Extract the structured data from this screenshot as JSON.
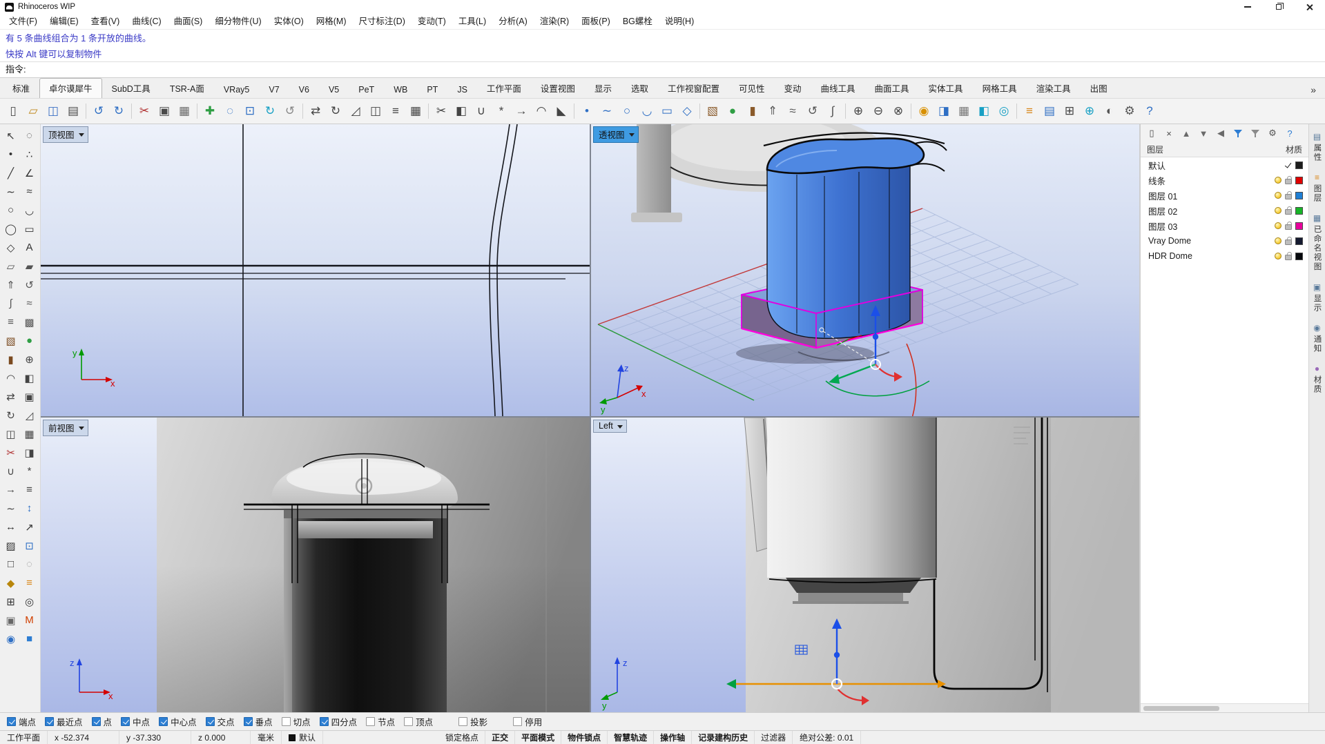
{
  "window": {
    "title": "Rhinoceros WIP"
  },
  "menu_bar": {
    "items": [
      "文件(F)",
      "编辑(E)",
      "查看(V)",
      "曲线(C)",
      "曲面(S)",
      "细分物件(U)",
      "实体(O)",
      "网格(M)",
      "尺寸标注(D)",
      "变动(T)",
      "工具(L)",
      "分析(A)",
      "渲染(R)",
      "面板(P)",
      "BG螺栓",
      "说明(H)"
    ]
  },
  "command_area": {
    "history": [
      "有 5 条曲线组合为 1 条开放的曲线。",
      "快按 Alt 键可以复制物件"
    ],
    "prompt": "指令:"
  },
  "tab_bar": {
    "active": "卓尔谟犀牛",
    "overflow_icon": "»",
    "tabs": [
      "标准",
      "卓尔谟犀牛",
      "SubD工具",
      "TSR-A面",
      "VRay5",
      "V7",
      "V6",
      "V5",
      "PeT",
      "WB",
      "PT",
      "JS",
      "工作平面",
      "设置视图",
      "显示",
      "选取",
      "工作视窗配置",
      "可见性",
      "变动",
      "曲线工具",
      "曲面工具",
      "实体工具",
      "网格工具",
      "渲染工具",
      "出图"
    ]
  },
  "toolbar": {
    "icons": [
      {
        "name": "new-file",
        "glyph": "▯",
        "color": "#4a4a4a"
      },
      {
        "name": "open-file",
        "glyph": "▱",
        "color": "#c08a20"
      },
      {
        "name": "save",
        "glyph": "◫",
        "color": "#3a6fc4"
      },
      {
        "name": "print",
        "glyph": "▤",
        "color": "#4a4a4a"
      },
      {
        "sep": true
      },
      {
        "name": "undo",
        "glyph": "↺",
        "color": "#2f6fc4"
      },
      {
        "name": "redo",
        "glyph": "↻",
        "color": "#2f6fc4"
      },
      {
        "sep": true
      },
      {
        "name": "cut",
        "glyph": "✂",
        "color": "#b03030"
      },
      {
        "name": "copy-clipboard",
        "glyph": "▣",
        "color": "#4a4a4a"
      },
      {
        "name": "paste",
        "glyph": "▦",
        "color": "#6a6a6a"
      },
      {
        "sep": true
      },
      {
        "name": "pan-view",
        "glyph": "✚",
        "color": "#2f9e44"
      },
      {
        "name": "zoom-window",
        "glyph": "◌",
        "color": "#2f6fc4"
      },
      {
        "name": "zoom-extents",
        "glyph": "⊡",
        "color": "#2f6fc4"
      },
      {
        "name": "rotate-view",
        "glyph": "↻",
        "color": "#18a0c4"
      },
      {
        "name": "undo-view",
        "glyph": "↺",
        "color": "#888888"
      },
      {
        "sep": true
      },
      {
        "name": "move",
        "glyph": "⇄",
        "color": "#444444"
      },
      {
        "name": "rotate",
        "glyph": "↻",
        "color": "#444444"
      },
      {
        "name": "scale",
        "glyph": "◿",
        "color": "#444444"
      },
      {
        "name": "mirror",
        "glyph": "◫",
        "color": "#444444"
      },
      {
        "name": "offset",
        "glyph": "≡",
        "color": "#444444"
      },
      {
        "name": "array",
        "glyph": "▦",
        "color": "#444444"
      },
      {
        "sep": true
      },
      {
        "name": "trim",
        "glyph": "✂",
        "color": "#444444"
      },
      {
        "name": "split",
        "glyph": "◧",
        "color": "#444444"
      },
      {
        "name": "join",
        "glyph": "∪",
        "color": "#444444"
      },
      {
        "name": "explode",
        "glyph": "*",
        "color": "#444444"
      },
      {
        "name": "extend",
        "glyph": "→",
        "color": "#444444"
      },
      {
        "name": "fillet",
        "glyph": "◠",
        "color": "#444444"
      },
      {
        "name": "chamfer",
        "glyph": "◣",
        "color": "#444444"
      },
      {
        "sep": true
      },
      {
        "name": "point",
        "glyph": "•",
        "color": "#2f6fc4"
      },
      {
        "name": "curve",
        "glyph": "∼",
        "color": "#2f6fc4"
      },
      {
        "name": "circle",
        "glyph": "○",
        "color": "#2f6fc4"
      },
      {
        "name": "arc",
        "glyph": "◡",
        "color": "#2f6fc4"
      },
      {
        "name": "rectangle",
        "glyph": "▭",
        "color": "#2f6fc4"
      },
      {
        "name": "polygon",
        "glyph": "◇",
        "color": "#2f6fc4"
      },
      {
        "sep": true
      },
      {
        "name": "box",
        "glyph": "▧",
        "color": "#8a5a2a"
      },
      {
        "name": "sphere",
        "glyph": "●",
        "color": "#2f9e44"
      },
      {
        "name": "cylinder",
        "glyph": "▮",
        "color": "#8a5a2a"
      },
      {
        "name": "extrude",
        "glyph": "⇑",
        "color": "#555555"
      },
      {
        "name": "loft",
        "glyph": "≈",
        "color": "#555555"
      },
      {
        "name": "revolve",
        "glyph": "↺",
        "color": "#555555"
      },
      {
        "name": "sweep",
        "glyph": "∫",
        "color": "#555555"
      },
      {
        "sep": true
      },
      {
        "name": "boolean-union",
        "glyph": "⊕",
        "color": "#444444"
      },
      {
        "name": "boolean-difference",
        "glyph": "⊖",
        "color": "#444444"
      },
      {
        "name": "boolean-intersection",
        "glyph": "⊗",
        "color": "#444444"
      },
      {
        "sep": true
      },
      {
        "name": "render",
        "glyph": "◉",
        "color": "#d89000"
      },
      {
        "name": "shaded-mode",
        "glyph": "◨",
        "color": "#2f6fc4"
      },
      {
        "name": "wireframe-mode",
        "glyph": "▦",
        "color": "#777777"
      },
      {
        "name": "ghosted-mode",
        "glyph": "◧",
        "color": "#18a0c4"
      },
      {
        "name": "xray-mode",
        "glyph": "◎",
        "color": "#18a0c4"
      },
      {
        "sep": true
      },
      {
        "name": "layer-panel",
        "glyph": "≡",
        "color": "#d8871a"
      },
      {
        "name": "properties-panel",
        "glyph": "▤",
        "color": "#2f6fc4"
      },
      {
        "name": "osnap-toggle",
        "glyph": "⊞",
        "color": "#444444"
      },
      {
        "name": "gumball-toggle",
        "glyph": "⊕",
        "color": "#18a0c4"
      },
      {
        "name": "record-history",
        "glyph": "◐",
        "color": "#555555"
      },
      {
        "name": "options",
        "glyph": "⚙",
        "color": "#555555"
      },
      {
        "name": "help",
        "glyph": "?",
        "color": "#2f6fc4"
      }
    ]
  },
  "left_toolbar": {
    "icons": [
      {
        "name": "select",
        "glyph": "↖",
        "color": "#333333"
      },
      {
        "name": "select-brush",
        "glyph": "◌",
        "color": "#333333"
      },
      {
        "name": "point",
        "glyph": "•",
        "color": "#333333"
      },
      {
        "name": "point-cloud",
        "glyph": "∴",
        "color": "#333333"
      },
      {
        "name": "line",
        "glyph": "╱",
        "color": "#333333"
      },
      {
        "name": "polyline",
        "glyph": "∠",
        "color": "#333333"
      },
      {
        "name": "curve",
        "glyph": "∼",
        "color": "#333333"
      },
      {
        "name": "curve-interpolate",
        "glyph": "≈",
        "color": "#333333"
      },
      {
        "name": "circle",
        "glyph": "○",
        "color": "#333333"
      },
      {
        "name": "arc",
        "glyph": "◡",
        "color": "#333333"
      },
      {
        "name": "ellipse",
        "glyph": "◯",
        "color": "#333333"
      },
      {
        "name": "rectangle",
        "glyph": "▭",
        "color": "#333333"
      },
      {
        "name": "polygon",
        "glyph": "◇",
        "color": "#333333"
      },
      {
        "name": "text",
        "glyph": "A",
        "color": "#333333"
      },
      {
        "name": "surface",
        "glyph": "▱",
        "color": "#555555"
      },
      {
        "name": "surface-corner",
        "glyph": "▰",
        "color": "#555555"
      },
      {
        "name": "extrude-surface",
        "glyph": "⇑",
        "color": "#555555"
      },
      {
        "name": "revolve-surface",
        "glyph": "↺",
        "color": "#555555"
      },
      {
        "name": "sweep1",
        "glyph": "∫",
        "color": "#555555"
      },
      {
        "name": "sweep2",
        "glyph": "≈",
        "color": "#555555"
      },
      {
        "name": "loft",
        "glyph": "≡",
        "color": "#555555"
      },
      {
        "name": "patch",
        "glyph": "▩",
        "color": "#555555"
      },
      {
        "name": "box",
        "glyph": "▧",
        "color": "#7a4a20"
      },
      {
        "name": "sphere",
        "glyph": "●",
        "color": "#2f9e44"
      },
      {
        "name": "cylinder",
        "glyph": "▮",
        "color": "#7a4a20"
      },
      {
        "name": "boolean-union",
        "glyph": "⊕",
        "color": "#444444"
      },
      {
        "name": "fillet-edge",
        "glyph": "◠",
        "color": "#444444"
      },
      {
        "name": "cap-holes",
        "glyph": "◧",
        "color": "#444444"
      },
      {
        "name": "move",
        "glyph": "⇄",
        "color": "#444444"
      },
      {
        "name": "copy",
        "glyph": "▣",
        "color": "#444444"
      },
      {
        "name": "rotate",
        "glyph": "↻",
        "color": "#444444"
      },
      {
        "name": "scale",
        "glyph": "◿",
        "color": "#444444"
      },
      {
        "name": "mirror",
        "glyph": "◫",
        "color": "#444444"
      },
      {
        "name": "array",
        "glyph": "▦",
        "color": "#444444"
      },
      {
        "name": "trim",
        "glyph": "✂",
        "color": "#b03030"
      },
      {
        "name": "split",
        "glyph": "◨",
        "color": "#444444"
      },
      {
        "name": "join",
        "glyph": "∪",
        "color": "#444444"
      },
      {
        "name": "explode",
        "glyph": "*",
        "color": "#444444"
      },
      {
        "name": "extend",
        "glyph": "→",
        "color": "#444444"
      },
      {
        "name": "offset",
        "glyph": "≡",
        "color": "#444444"
      },
      {
        "name": "blend",
        "glyph": "∼",
        "color": "#444444"
      },
      {
        "name": "analyze-direction",
        "glyph": "↕",
        "color": "#2f6fc4"
      },
      {
        "name": "dimension",
        "glyph": "↔",
        "color": "#333333"
      },
      {
        "name": "leader",
        "glyph": "↗",
        "color": "#333333"
      },
      {
        "name": "hatch",
        "glyph": "▨",
        "color": "#333333"
      },
      {
        "name": "block",
        "glyph": "⊡",
        "color": "#2f6fc4"
      },
      {
        "name": "group",
        "glyph": "□",
        "color": "#333333"
      },
      {
        "name": "hide",
        "glyph": "◌",
        "color": "#888888"
      },
      {
        "name": "lock",
        "glyph": "◆",
        "color": "#b8860b"
      },
      {
        "name": "layer-tools",
        "glyph": "≡",
        "color": "#d8871a"
      },
      {
        "name": "cplane-tools",
        "glyph": "⊞",
        "color": "#333333"
      },
      {
        "name": "named-views",
        "glyph": "◎",
        "color": "#333333"
      },
      {
        "name": "camera",
        "glyph": "▣",
        "color": "#666666"
      },
      {
        "name": "vray-material",
        "glyph": "M",
        "color": "#d04000"
      },
      {
        "name": "vray-render",
        "glyph": "◉",
        "color": "#2f6fc4"
      },
      {
        "name": "display-panel",
        "glyph": "■",
        "color": "#2d7dd2"
      }
    ]
  },
  "viewports": {
    "top": {
      "label": "顶视图",
      "axis": {
        "x": "x",
        "y": "y"
      }
    },
    "perspective": {
      "label": "透视图",
      "axis": {
        "x": "x",
        "y": "y",
        "z": "z"
      }
    },
    "front": {
      "label": "前视图",
      "axis": {
        "x": "x",
        "z": "z"
      }
    },
    "left": {
      "label": "Left",
      "axis": {
        "y": "y",
        "z": "z"
      }
    }
  },
  "layers_panel": {
    "toolbar_icons": [
      {
        "name": "new-layer",
        "glyph": "▯",
        "color": "#4a4a4a"
      },
      {
        "name": "delete-layer",
        "glyph": "×",
        "color": "#4a4a4a"
      },
      {
        "name": "move-layer-up",
        "glyph": "▲",
        "color": "#6a6a6a"
      },
      {
        "name": "move-layer-down",
        "glyph": "▼",
        "color": "#6a6a6a"
      },
      {
        "name": "collapse-layers",
        "glyph": "◀",
        "color": "#6a6a6a"
      },
      {
        "name": "filter-layers",
        "funnel": true,
        "color": "#2d7dd3"
      },
      {
        "name": "layer-filter-tools",
        "funnel": true,
        "color": "#8a8a8a"
      },
      {
        "name": "layer-settings",
        "glyph": "⚙",
        "color": "#555555"
      },
      {
        "name": "panel-help",
        "glyph": "?",
        "color": "#2d7dd3"
      }
    ],
    "header": {
      "name_col": "图层",
      "material_col": "材质"
    },
    "layers": [
      {
        "name": "默认",
        "current": true,
        "color": "#1c1c1c"
      },
      {
        "name": "线条",
        "color": "#e00000"
      },
      {
        "name": "图层 01",
        "color": "#1f7fd4"
      },
      {
        "name": "图层 02",
        "color": "#18b428"
      },
      {
        "name": "图层 03",
        "color": "#e8009c"
      },
      {
        "name": "Vray Dome",
        "color": "#161a30"
      },
      {
        "name": "HDR Dome",
        "color": "#06080c"
      }
    ]
  },
  "side_tabs": [
    {
      "label": "属性",
      "glyph": "▤",
      "color": "#5a7a9a"
    },
    {
      "label": "图层",
      "glyph": "≡",
      "color": "#d8871a"
    },
    {
      "label": "已命名视图",
      "glyph": "▦",
      "color": "#5a7a9a"
    },
    {
      "label": "显示",
      "glyph": "▣",
      "color": "#5a7a9a"
    },
    {
      "label": "通知",
      "glyph": "◉",
      "color": "#5a7a9a"
    },
    {
      "label": "材质",
      "glyph": "●",
      "color": "#9a6ab8"
    }
  ],
  "osnap_bar": {
    "items": [
      {
        "label": "端点",
        "checked": true
      },
      {
        "label": "最近点",
        "checked": true
      },
      {
        "label": "点",
        "checked": true
      },
      {
        "label": "中点",
        "checked": true
      },
      {
        "label": "中心点",
        "checked": true
      },
      {
        "label": "交点",
        "checked": true
      },
      {
        "label": "垂点",
        "checked": true
      },
      {
        "label": "切点",
        "checked": false
      },
      {
        "label": "四分点",
        "checked": true
      },
      {
        "label": "节点",
        "checked": false
      },
      {
        "label": "顶点",
        "checked": false
      },
      {
        "label": "投影",
        "checked": false,
        "gap": true
      },
      {
        "label": "停用",
        "checked": false,
        "gap": true
      }
    ]
  },
  "status_bar": {
    "cplane": "工作平面",
    "x": "x -52.374",
    "y": "y -37.330",
    "z": "z 0.000",
    "units": "毫米",
    "layer": "默认",
    "toggles": [
      {
        "label": "锁定格点",
        "active": false
      },
      {
        "label": "正交",
        "active": true
      },
      {
        "label": "平面模式",
        "active": true
      },
      {
        "label": "物件锁点",
        "active": true
      },
      {
        "label": "智慧轨迹",
        "active": true
      },
      {
        "label": "操作轴",
        "active": true
      },
      {
        "label": "记录建构历史",
        "active": true
      },
      {
        "label": "过滤器",
        "active": false
      }
    ],
    "tolerance": "绝对公差: 0.01"
  }
}
